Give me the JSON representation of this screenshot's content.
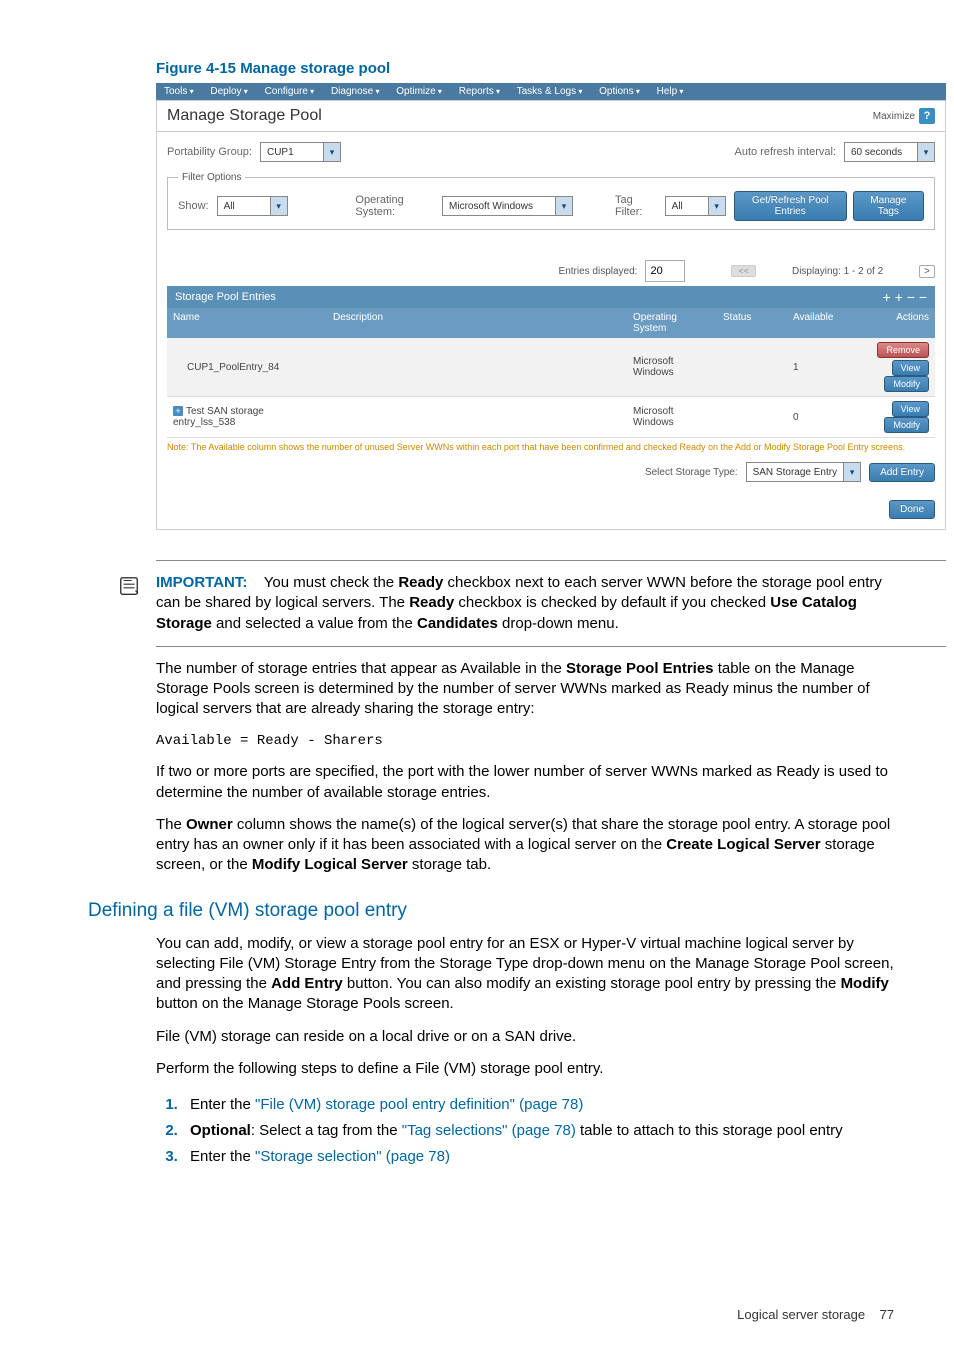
{
  "figure_caption": "Figure 4-15 Manage storage pool",
  "screenshot": {
    "menubar": [
      "Tools",
      "Deploy",
      "Configure",
      "Diagnose",
      "Optimize",
      "Reports",
      "Tasks & Logs",
      "Options",
      "Help"
    ],
    "title": "Manage Storage Pool",
    "maximize": "Maximize",
    "portability_label": "Portability Group:",
    "portability_value": "CUP1",
    "refresh_label": "Auto refresh interval:",
    "refresh_value": "60 seconds",
    "filter_legend": "Filter Options",
    "show_label": "Show:",
    "show_value": "All",
    "os_label": "Operating System:",
    "os_value": "Microsoft Windows",
    "tag_label": "Tag Filter:",
    "tag_value": "All",
    "btn_refresh": "Get/Refresh Pool Entries",
    "btn_tags": "Manage Tags",
    "entries_label": "Entries displayed:",
    "entries_value": "20",
    "displaying": "Displaying: 1 - 2 of 2",
    "grid_title": "Storage Pool Entries",
    "columns": {
      "name": "Name",
      "desc": "Description",
      "os": "Operating System",
      "status": "Status",
      "avail": "Available",
      "actions": "Actions"
    },
    "rows": [
      {
        "name": "CUP1_PoolEntry_84",
        "os": "Microsoft Windows",
        "avail": "1",
        "has_remove": true
      },
      {
        "name": "Test SAN storage entry_lss_538",
        "os": "Microsoft Windows",
        "avail": "0",
        "has_remove": false,
        "expandable": true
      }
    ],
    "btn_view": "View",
    "btn_modify": "Modify",
    "btn_remove": "Remove",
    "note": "Note: The Available column shows the number of unused Server WWNs within each port that have been confirmed and checked Ready on the Add or Modify Storage Pool Entry screens.",
    "storage_type_label": "Select Storage Type:",
    "storage_type_value": "SAN Storage Entry",
    "btn_add": "Add Entry",
    "btn_done": "Done"
  },
  "important": {
    "label": "IMPORTANT:",
    "text_before": "You must check the ",
    "ready": "Ready",
    "text_mid1": " checkbox next to each server WWN before the storage pool entry can be shared by logical servers. The ",
    "text_mid2": " checkbox is checked by default if you checked ",
    "use_catalog": "Use Catalog Storage",
    "text_mid3": " and selected a value from the ",
    "candidates": "Candidates",
    "text_end": " drop-down menu."
  },
  "para1_a": "The number of storage entries that appear as Available in the ",
  "para1_b": "Storage Pool Entries",
  "para1_c": " table on the Manage Storage Pools screen is determined by the number of server WWNs marked as Ready minus the number of logical servers that are already sharing the storage entry:",
  "formula": "Available = Ready - Sharers",
  "para2": "If two or more ports are specified, the port with the lower number of server WWNs marked as Ready is used to determine the number of available storage entries.",
  "para3_a": "The ",
  "para3_owner": "Owner",
  "para3_b": " column shows the name(s) of the logical server(s) that share the storage pool entry. A storage pool entry has an owner only if it has been associated with a logical server on the ",
  "para3_cls": "Create Logical Server",
  "para3_c": " storage screen, or the ",
  "para3_mls": "Modify Logical Server",
  "para3_d": " storage tab.",
  "section_title": "Defining a file (VM) storage pool entry",
  "section_para1_a": "You can add, modify, or view a storage pool entry for an ESX or Hyper-V virtual machine logical server by selecting File (VM) Storage Entry from the Storage Type drop-down menu on the Manage Storage Pool screen, and pressing the ",
  "section_para1_add": "Add Entry",
  "section_para1_b": " button. You can also modify an existing storage pool entry by pressing the ",
  "section_para1_modify": "Modify",
  "section_para1_c": " button on the Manage Storage Pools screen.",
  "section_para2": "File (VM) storage can reside on a local drive or on a SAN drive.",
  "section_para3": "Perform the following steps to define a File (VM) storage pool entry.",
  "steps": {
    "s1_a": "Enter the ",
    "s1_link": "\"File (VM) storage pool entry definition\" (page 78)",
    "s2_opt": "Optional",
    "s2_a": ": Select a tag from the ",
    "s2_link": "\"Tag selections\" (page 78)",
    "s2_b": " table to attach to this storage pool entry",
    "s3_a": "Enter the ",
    "s3_link": "\"Storage selection\" (page 78)"
  },
  "footer": {
    "section": "Logical server storage",
    "page": "77"
  }
}
